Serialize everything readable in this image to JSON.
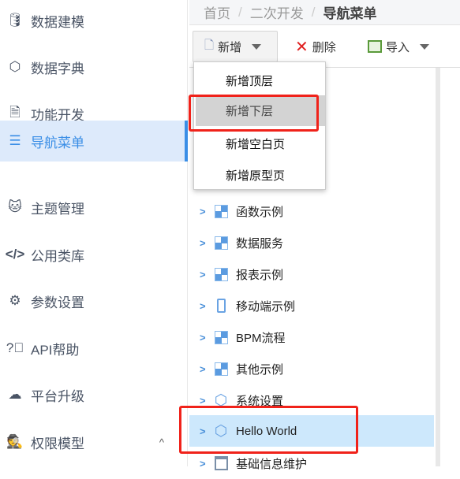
{
  "sidebar": {
    "items": [
      {
        "label": "数据建模",
        "icon": "database-icon"
      },
      {
        "label": "数据字典",
        "icon": "cube-icon"
      },
      {
        "label": "功能开发",
        "icon": "code-file-icon"
      },
      {
        "label": "导航菜单",
        "icon": "bars-icon",
        "active": true
      },
      {
        "label": "主题管理",
        "icon": "github-icon"
      },
      {
        "label": "公用类库",
        "icon": "code-icon"
      },
      {
        "label": "参数设置",
        "icon": "gear-icon"
      },
      {
        "label": "API帮助",
        "icon": "question-circle-icon"
      },
      {
        "label": "平台升级",
        "icon": "cloud-download-icon"
      },
      {
        "label": "权限模型",
        "icon": "user-secret-icon",
        "expand": "^"
      }
    ]
  },
  "breadcrumb": {
    "items": [
      "首页",
      "二次开发"
    ],
    "separator": "/",
    "current": "导航菜单"
  },
  "toolbar": {
    "add": "新增",
    "delete": "删除",
    "import": "导入"
  },
  "add_menu": {
    "items": [
      "新增顶层",
      "新增下层",
      "新增空白页",
      "新增原型页"
    ],
    "hovered": "新增下层"
  },
  "tree": {
    "rows": [
      {
        "label": "函数示例",
        "icon": "grid-icon"
      },
      {
        "label": "数据服务",
        "icon": "grid-icon"
      },
      {
        "label": "报表示例",
        "icon": "grid-icon"
      },
      {
        "label": "移动端示例",
        "icon": "mobile-icon"
      },
      {
        "label": "BPM流程",
        "icon": "grid-icon"
      },
      {
        "label": "其他示例",
        "icon": "grid-icon"
      },
      {
        "label": "系统设置",
        "icon": "cube-icon"
      },
      {
        "label": "Hello World",
        "icon": "cube-icon",
        "selected": true
      },
      {
        "label": "基础信息维护",
        "icon": "window-icon"
      }
    ]
  },
  "colors": {
    "accent": "#3a8ee6",
    "active_bg": "#ddeafb",
    "selected_row": "#cde8fc",
    "highlight": "#f0221a"
  }
}
